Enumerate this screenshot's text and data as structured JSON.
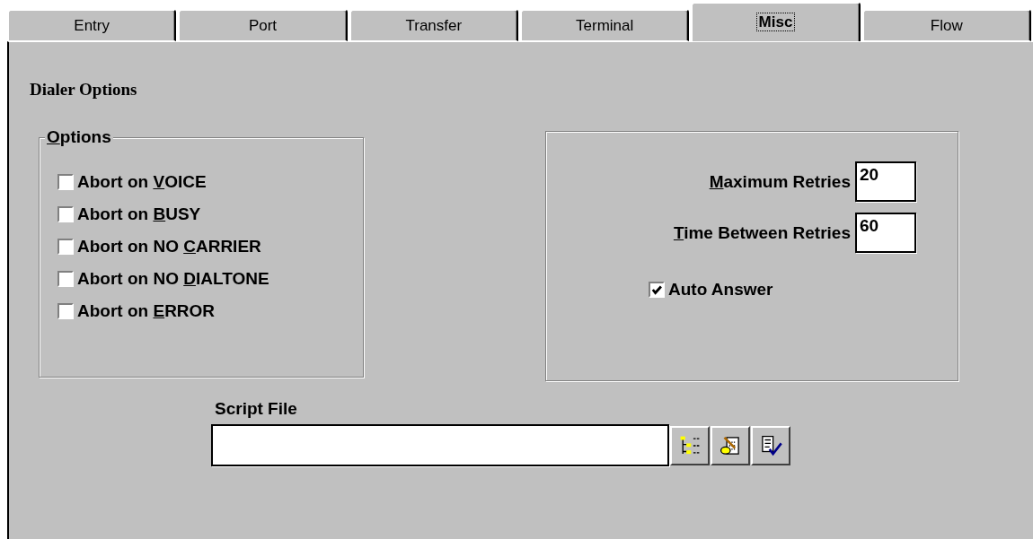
{
  "tabs": [
    {
      "label": "Entry",
      "selected": false
    },
    {
      "label": "Port",
      "selected": false
    },
    {
      "label": "Transfer",
      "selected": false
    },
    {
      "label": "Terminal",
      "selected": false
    },
    {
      "label": "Misc",
      "selected": true
    },
    {
      "label": "Flow",
      "selected": false
    }
  ],
  "section_title": "Dialer Options",
  "options_group": {
    "title_parts": [
      "O",
      "ptions"
    ],
    "items": [
      {
        "label_parts": [
          "Abort on ",
          "V",
          "OICE"
        ],
        "checked": false
      },
      {
        "label_parts": [
          "Abort on ",
          "B",
          "USY"
        ],
        "checked": false
      },
      {
        "label_parts": [
          "Abort on NO ",
          "C",
          "ARRIER"
        ],
        "checked": false
      },
      {
        "label_parts": [
          "Abort on NO ",
          "D",
          "IALTONE"
        ],
        "checked": false
      },
      {
        "label_parts": [
          "Abort on ",
          "E",
          "RROR"
        ],
        "checked": false
      }
    ]
  },
  "retries_group": {
    "fields": [
      {
        "label_parts": [
          "M",
          "aximum Retries"
        ],
        "value": "20"
      },
      {
        "label_parts": [
          "T",
          "ime Between Retries"
        ],
        "value": "60"
      }
    ],
    "auto_answer": {
      "label": "Auto Answer",
      "checked": true
    }
  },
  "script_file": {
    "label": "Script File"
  }
}
